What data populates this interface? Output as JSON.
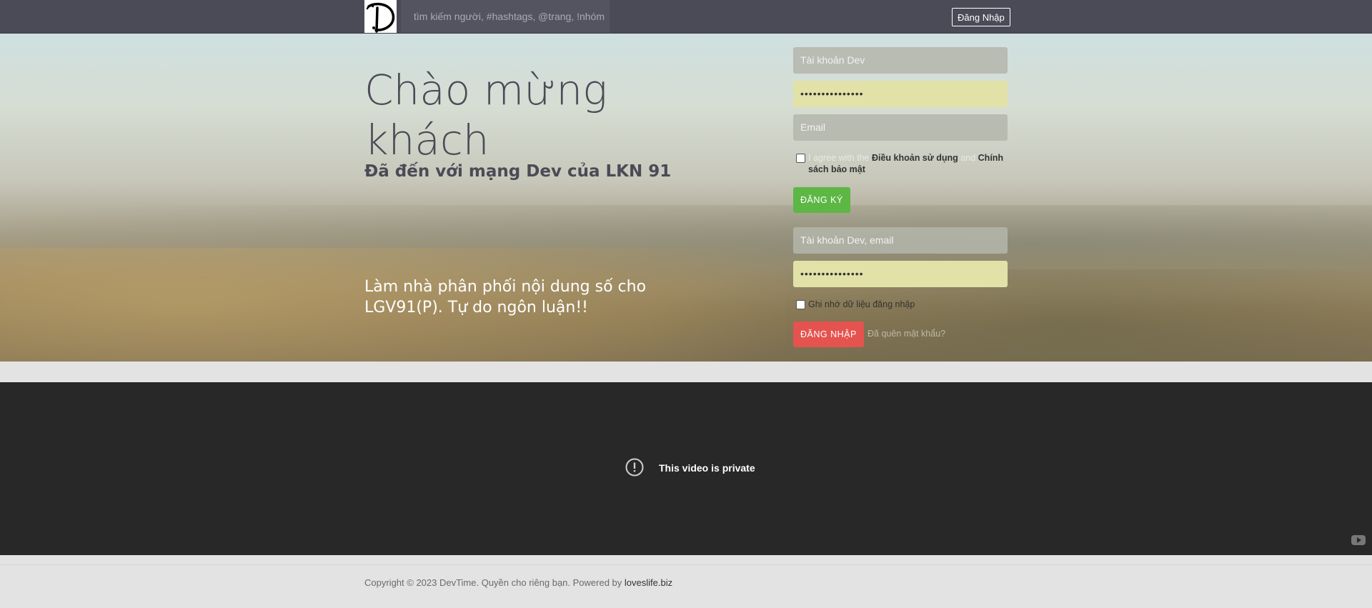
{
  "header": {
    "logo_alt": "D",
    "search_placeholder": "tìm kiếm người, #hashtags, @trang, !nhóm",
    "login_button": "Đăng Nhập"
  },
  "hero": {
    "title": "Chào mừng khách",
    "subtitle": "Đã đến với mạng Dev của LKN 91",
    "tagline": "Làm nhà phân phối nội dung số cho LGV91(P). Tự do ngôn luận!!"
  },
  "register": {
    "username_placeholder": "Tài khoản Dev",
    "password_value": "•••••••••••••••",
    "email_placeholder": "Email",
    "agree_prefix": "I agree with the",
    "terms_link": "Điều khoản sử dụng",
    "and_text": "and",
    "privacy_link": "Chính sách bảo mật",
    "submit_button": "ĐĂNG KÝ"
  },
  "login": {
    "username_placeholder": "Tài khoản Dev, email",
    "password_value": "•••••••••••••••",
    "remember_label": "Ghi nhớ dữ liệu đăng nhập",
    "submit_button": "ĐĂNG NHẬP",
    "forgot_link": "Đã quên mật khẩu?"
  },
  "video": {
    "message": "This video is private",
    "icon": "exclamation-circle-icon"
  },
  "footer": {
    "copyright": "Copyright © 2023 DevTime. Quyền cho riêng bạn. Powered by",
    "powered_link": "loveslife.biz"
  },
  "colors": {
    "topbar": "#4a4b57",
    "green_button": "#5cb745",
    "red_button": "#e5534e",
    "video_bg": "#282828"
  }
}
